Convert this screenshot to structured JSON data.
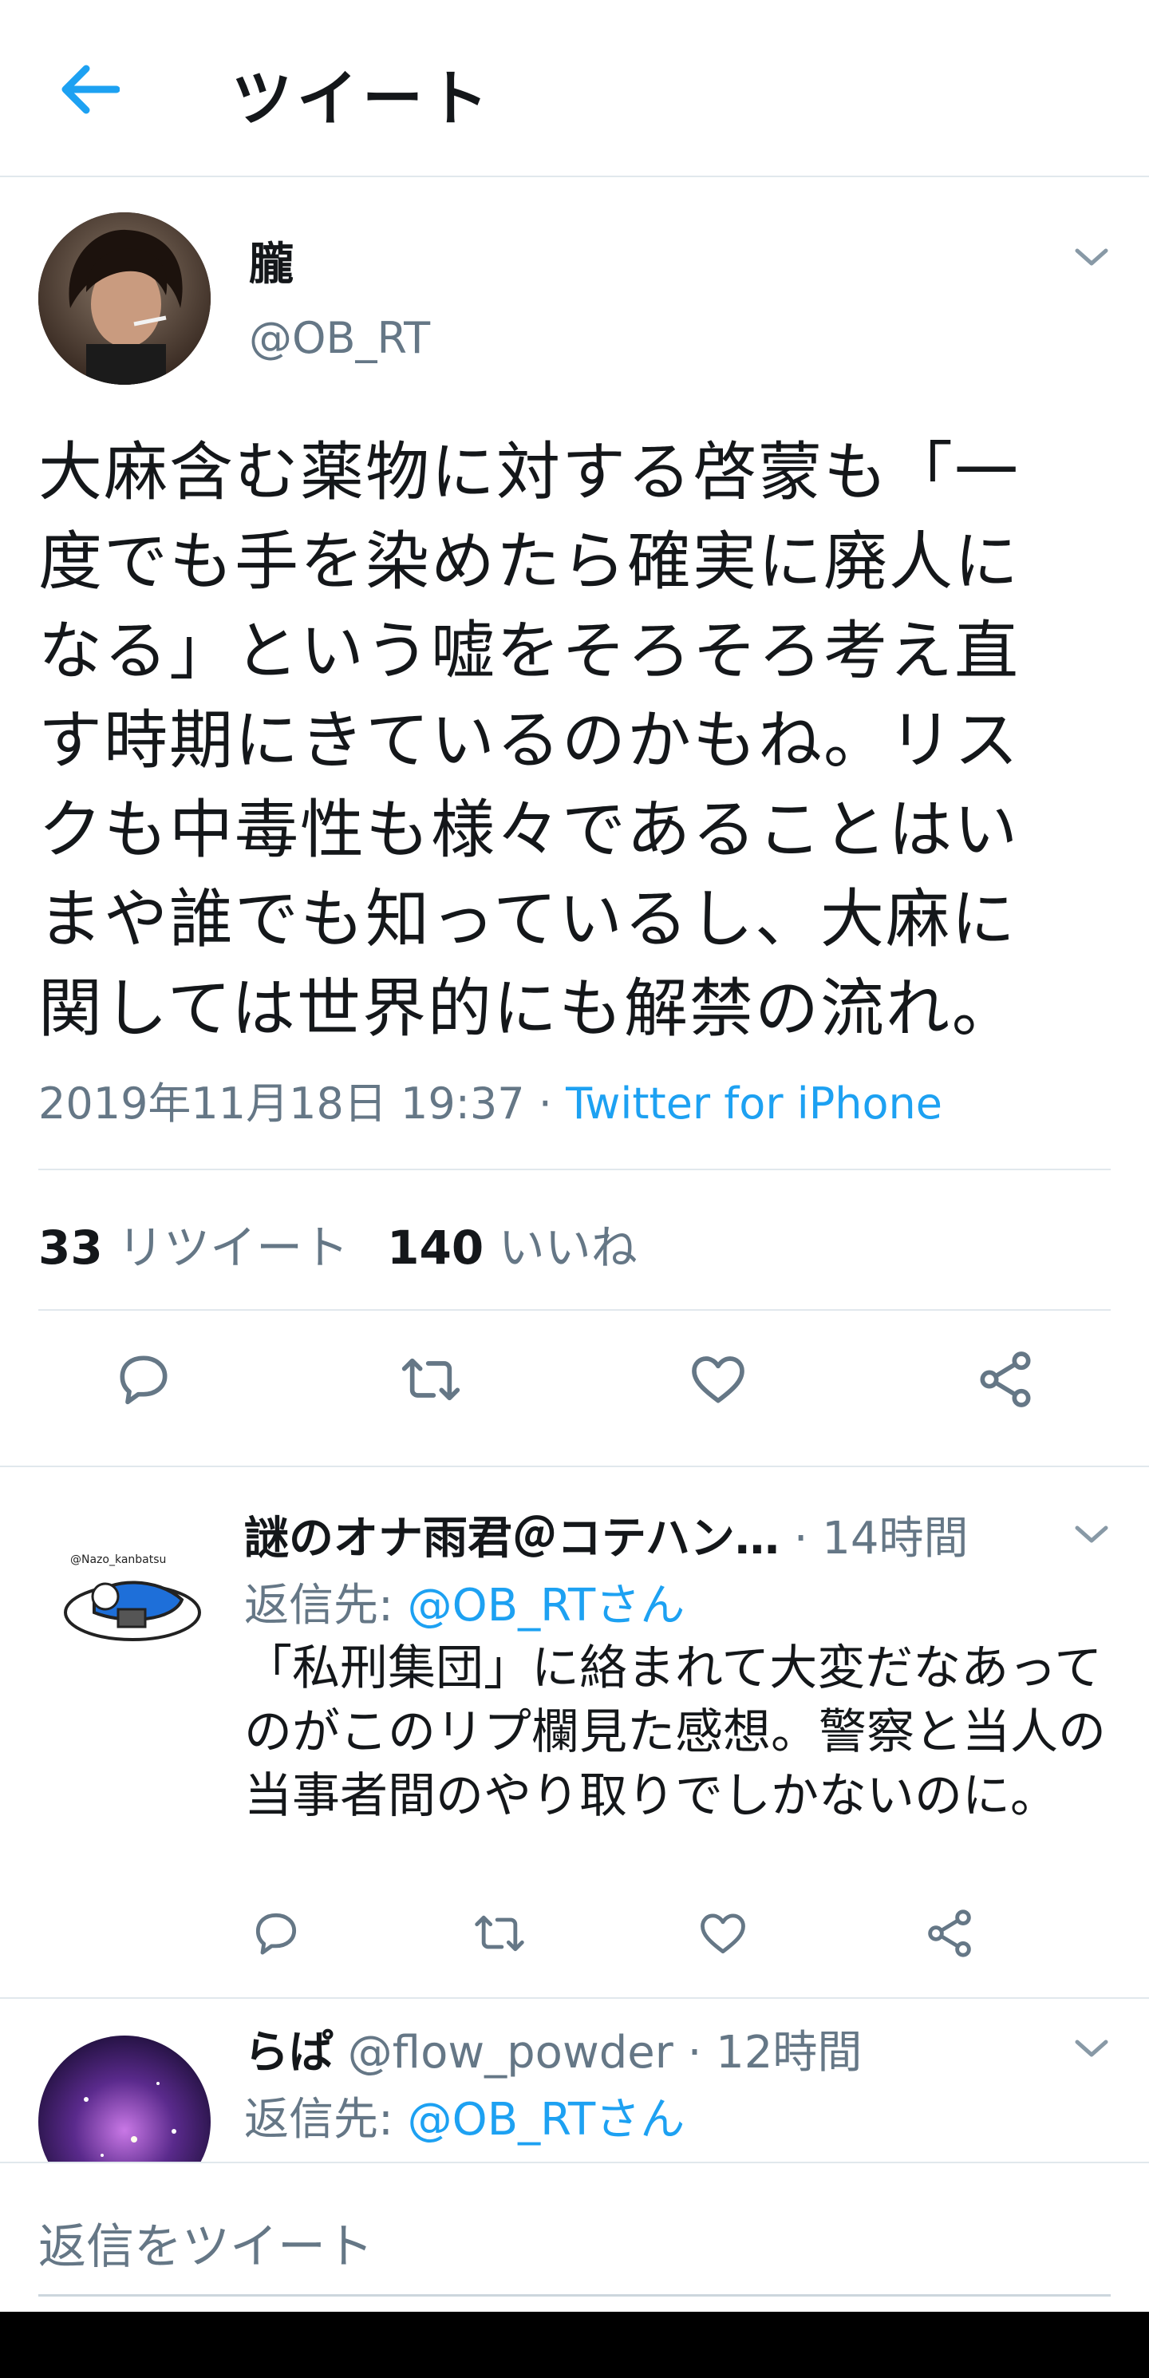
{
  "header": {
    "back_icon": "arrow-left-icon",
    "title": "ツイート"
  },
  "tweet": {
    "author_name": "朧",
    "author_handle": "@OB_RT",
    "text_lines": [
      "大麻含む薬物に対する啓蒙も「一",
      "度でも手を染めたら確実に廃人に",
      "なる」という嘘をそろそろ考え直",
      "す時期にきているのかもね。リス",
      "クも中毒性も様々であることはい",
      "まや誰でも知っているし、大麻に",
      "関しては世界的にも解禁の流れ。"
    ],
    "timestamp": "2019年11月18日 19:37",
    "separator": " · ",
    "source": "Twitter for iPhone",
    "retweet_count": "33",
    "retweet_label": "リツイート",
    "like_count": "140",
    "like_label": "いいね",
    "action_icons": [
      "reply-icon",
      "retweet-icon",
      "like-icon",
      "share-icon"
    ]
  },
  "replies": [
    {
      "name": "謎のオナ雨君＠コテハン…",
      "meta": " · 14時間",
      "reply_to_label": "返信先: ",
      "reply_to_handle": "@OB_RTさん",
      "avatar_caption": "@Nazo_kanbatsu",
      "text_lines": [
        "「私刑集団」に絡まれて大変だなあって",
        "のがこのリプ欄見た感想。警察と当人の",
        "当事者間のやり取りでしかないのに。"
      ]
    },
    {
      "name": "らぱ",
      "meta": " @flow_powder · 12時間",
      "reply_to_label": "返信先: ",
      "reply_to_handle": "@OB_RTさん"
    }
  ],
  "compose": {
    "placeholder": "返信をツイート"
  },
  "colors": {
    "accent": "#1da1f2",
    "secondary_text": "#657786",
    "primary_text": "#14171a",
    "divider": "#e1e8ed"
  }
}
